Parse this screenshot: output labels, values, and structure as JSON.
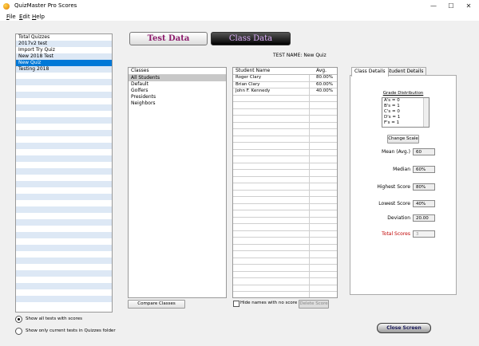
{
  "window": {
    "title": "QuizMaster Pro Scores",
    "minimize": "—",
    "maximize": "☐",
    "close": "✕"
  },
  "menu": [
    {
      "first": "F",
      "rest": "ile"
    },
    {
      "first": "E",
      "rest": "dit"
    },
    {
      "first": "H",
      "rest": "elp"
    }
  ],
  "quizzes": {
    "items": [
      "Total Quizzes",
      "2017v2 test",
      "Import Try Quiz",
      "New 2018 Test",
      "New Quiz",
      "Testing 2018"
    ],
    "selected_index": 4
  },
  "filter_options": {
    "show_all": "Show all tests with scores",
    "show_current": "Show only current tests in Quizzes folder"
  },
  "mode_tabs": {
    "test_data": "Test Data",
    "class_data": "Class Data"
  },
  "test_name": "TEST NAME: New Quiz",
  "classes": {
    "header": "Classes",
    "items": [
      "All Students",
      "Default",
      "Golfers",
      "Presidents",
      "Neighbors"
    ],
    "selected_index": 0,
    "compare_button": "Compare Classes"
  },
  "students": {
    "header_name": "Student Name",
    "header_avg": "Avg.",
    "rows": [
      {
        "name": "Roger Clary",
        "avg": "80.00%"
      },
      {
        "name": "Brian Clary",
        "avg": "60.00%"
      },
      {
        "name": "John F. Kennedy",
        "avg": "40.00%"
      }
    ],
    "hide_label": "Hide names with no score",
    "delete_button": "Delete Score"
  },
  "details": {
    "tabs": [
      "Class Details",
      "Student Details"
    ],
    "grade_title": "Grade Distribution",
    "grades": [
      "A's = 0",
      "B's = 1",
      "C's = 0",
      "D's = 1",
      "F's = 1"
    ],
    "change_scale": "Change Scale",
    "stats": [
      {
        "label": "Mean (Avg.)",
        "value": "60"
      },
      {
        "label": "Median",
        "value": "60%"
      },
      {
        "label": "Highest Score",
        "value": "80%"
      },
      {
        "label": "Lowest Score",
        "value": "40%"
      },
      {
        "label": "Deviation",
        "value": "20.00"
      },
      {
        "label": "Total Scores",
        "value": "3"
      }
    ]
  },
  "close_button": "Close Screen"
}
